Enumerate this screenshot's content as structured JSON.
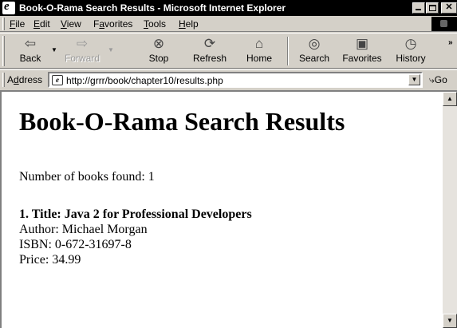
{
  "window": {
    "title": "Book-O-Rama Search Results - Microsoft Internet Explorer"
  },
  "menu": {
    "items": [
      {
        "hotkey": "F",
        "rest": "ile"
      },
      {
        "hotkey": "E",
        "rest": "dit"
      },
      {
        "hotkey": "V",
        "rest": "iew"
      },
      {
        "pre": "F",
        "hotkey": "a",
        "rest": "vorites"
      },
      {
        "hotkey": "T",
        "rest": "ools"
      },
      {
        "hotkey": "H",
        "rest": "elp"
      }
    ]
  },
  "toolbar": {
    "buttons": [
      {
        "label": "Back",
        "icon": "back-arrow-icon",
        "glyph": "⇦",
        "enabled": true
      },
      {
        "label": "Forward",
        "icon": "forward-arrow-icon",
        "glyph": "⇨",
        "enabled": false
      },
      {
        "label": "Stop",
        "icon": "stop-icon",
        "glyph": "⊗",
        "enabled": true
      },
      {
        "label": "Refresh",
        "icon": "refresh-icon",
        "glyph": "⟳",
        "enabled": true
      },
      {
        "label": "Home",
        "icon": "home-icon",
        "glyph": "⌂",
        "enabled": true
      },
      {
        "label": "Search",
        "icon": "search-icon",
        "glyph": "◎",
        "enabled": true
      },
      {
        "label": "Favorites",
        "icon": "favorites-icon",
        "glyph": "▣",
        "enabled": true
      },
      {
        "label": "History",
        "icon": "history-icon",
        "glyph": "◷",
        "enabled": true
      }
    ]
  },
  "address": {
    "label_hotkey": "d",
    "label_pre": "A",
    "label_rest": "dress",
    "url": "http://grrr/book/chapter10/results.php",
    "go_label": "Go"
  },
  "page": {
    "heading": "Book-O-Rama Search Results",
    "count_label": "Number of books found:",
    "count_value": "1",
    "books": [
      {
        "title_line": "1. Title: Java 2 for Professional Developers",
        "author_line": "Author: Michael Morgan",
        "isbn_line": "ISBN: 0-672-31697-8",
        "price_line": "Price: 34.99"
      }
    ]
  },
  "colors": {
    "titlebar_bg": "#000000",
    "chrome_bg": "#d4d0c8",
    "content_bg": "#ffffff"
  }
}
